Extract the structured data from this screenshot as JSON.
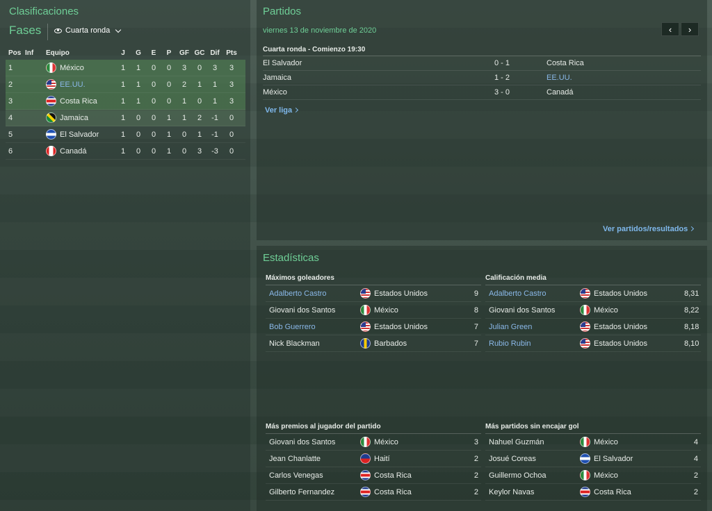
{
  "standings_panel": {
    "title": "Clasificaciones",
    "stage_label": "Fases",
    "stage_select": "Cuarta ronda",
    "headers": [
      "Pos",
      "Inf",
      "Equipo",
      "J",
      "G",
      "E",
      "P",
      "GF",
      "GC",
      "Dif",
      "Pts"
    ],
    "rows": [
      {
        "pos": "1",
        "team": "México",
        "flag": "mex",
        "j": "1",
        "g": "1",
        "e": "0",
        "p": "0",
        "gf": "3",
        "gc": "0",
        "dif": "3",
        "pts": "3",
        "zone": "q",
        "link": false
      },
      {
        "pos": "2",
        "team": "EE.UU.",
        "flag": "usa",
        "j": "1",
        "g": "1",
        "e": "0",
        "p": "0",
        "gf": "2",
        "gc": "1",
        "dif": "1",
        "pts": "3",
        "zone": "q",
        "link": true
      },
      {
        "pos": "3",
        "team": "Costa Rica",
        "flag": "crc",
        "j": "1",
        "g": "1",
        "e": "0",
        "p": "0",
        "gf": "1",
        "gc": "0",
        "dif": "1",
        "pts": "3",
        "zone": "q",
        "link": false
      },
      {
        "pos": "4",
        "team": "Jamaica",
        "flag": "jam",
        "j": "1",
        "g": "0",
        "e": "0",
        "p": "1",
        "gf": "1",
        "gc": "2",
        "dif": "-1",
        "pts": "0",
        "zone": "p",
        "link": false
      },
      {
        "pos": "5",
        "team": "El Salvador",
        "flag": "slv",
        "j": "1",
        "g": "0",
        "e": "0",
        "p": "1",
        "gf": "0",
        "gc": "1",
        "dif": "-1",
        "pts": "0",
        "zone": "",
        "link": false
      },
      {
        "pos": "6",
        "team": "Canadá",
        "flag": "can",
        "j": "1",
        "g": "0",
        "e": "0",
        "p": "1",
        "gf": "0",
        "gc": "3",
        "dif": "-3",
        "pts": "0",
        "zone": "",
        "link": false
      }
    ]
  },
  "matches_panel": {
    "title": "Partidos",
    "date": "viernes 13 de noviembre de 2020",
    "prev_icon": "‹",
    "next_icon": "›",
    "round_header": "Cuarta ronda - Comienzo 19:30",
    "matches": [
      {
        "home": "El Salvador",
        "score": "0 - 1",
        "away": "Costa Rica",
        "away_link": false
      },
      {
        "home": "Jamaica",
        "score": "1 - 2",
        "away": "EE.UU.",
        "away_link": true
      },
      {
        "home": "México",
        "score": "3 - 0",
        "away": "Canadá",
        "away_link": false
      }
    ],
    "league_link": "Ver liga",
    "results_link": "Ver partidos/resultados"
  },
  "stats_panel": {
    "title": "Estadísticas",
    "blocks": {
      "goals": {
        "title": "Máximos goleadores",
        "rows": [
          {
            "player": "Adalberto Castro",
            "team": "Estados Unidos",
            "flag": "usa",
            "value": "9",
            "link": true
          },
          {
            "player": "Giovani dos Santos",
            "team": "México",
            "flag": "mex",
            "value": "8",
            "link": false
          },
          {
            "player": "Bob Guerrero",
            "team": "Estados Unidos",
            "flag": "usa",
            "value": "7",
            "link": true
          },
          {
            "player": "Nick Blackman",
            "team": "Barbados",
            "flag": "brb",
            "value": "7",
            "link": false
          }
        ]
      },
      "rating": {
        "title": "Calificación media",
        "rows": [
          {
            "player": "Adalberto Castro",
            "team": "Estados Unidos",
            "flag": "usa",
            "value": "8,31",
            "link": true
          },
          {
            "player": "Giovani dos Santos",
            "team": "México",
            "flag": "mex",
            "value": "8,22",
            "link": false
          },
          {
            "player": "Julian Green",
            "team": "Estados Unidos",
            "flag": "usa",
            "value": "8,18",
            "link": true
          },
          {
            "player": "Rubio Rubin",
            "team": "Estados Unidos",
            "flag": "usa",
            "value": "8,10",
            "link": true
          }
        ]
      },
      "potm": {
        "title": "Más premios al jugador del partido",
        "rows": [
          {
            "player": "Giovani dos Santos",
            "team": "México",
            "flag": "mex",
            "value": "3",
            "link": false
          },
          {
            "player": "Jean Chanlatte",
            "team": "Haití",
            "flag": "hai",
            "value": "2",
            "link": false
          },
          {
            "player": "Carlos Venegas",
            "team": "Costa Rica",
            "flag": "crc",
            "value": "2",
            "link": false
          },
          {
            "player": "Gilberto Fernandez",
            "team": "Costa Rica",
            "flag": "crc",
            "value": "2",
            "link": false
          }
        ]
      },
      "clean": {
        "title": "Más partidos sin encajar gol",
        "rows": [
          {
            "player": "Nahuel Guzmán",
            "team": "México",
            "flag": "mex",
            "value": "4",
            "link": false
          },
          {
            "player": "Josué Coreas",
            "team": "El Salvador",
            "flag": "slv",
            "value": "4",
            "link": false
          },
          {
            "player": "Guillermo Ochoa",
            "team": "México",
            "flag": "mex",
            "value": "2",
            "link": false
          },
          {
            "player": "Keylor Navas",
            "team": "Costa Rica",
            "flag": "crc",
            "value": "2",
            "link": false
          }
        ]
      }
    }
  }
}
